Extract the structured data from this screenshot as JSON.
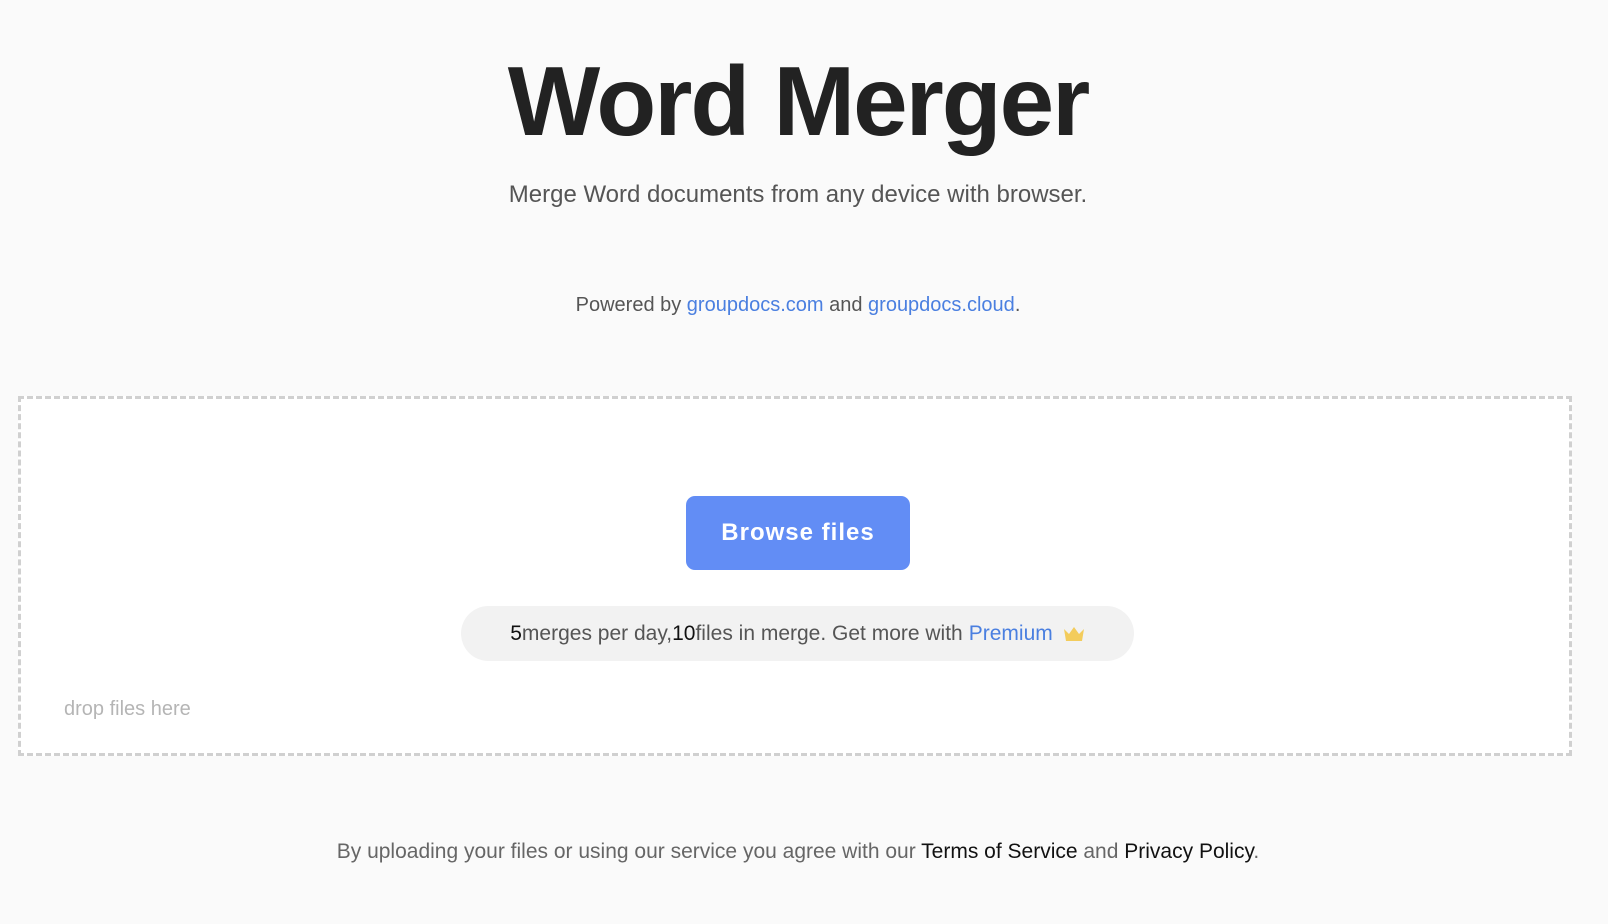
{
  "header": {
    "title": "Word Merger",
    "subtitle": "Merge Word documents from any device with browser."
  },
  "powered": {
    "prefix": "Powered by ",
    "link1": "groupdocs.com",
    "middle": " and ",
    "link2": "groupdocs.cloud",
    "suffix": "."
  },
  "dropzone": {
    "browse_label": "Browse files",
    "drop_hint": "drop files here",
    "limits": {
      "merges": "5",
      "merges_text": " merges per day, ",
      "files": "10",
      "files_text": " files in merge. Get more with",
      "premium_label": "Premium",
      "premium_icon": "crown-icon"
    }
  },
  "footer": {
    "prefix": "By uploading your files or using our service you agree with our ",
    "terms_label": "Terms of Service",
    "middle": " and ",
    "privacy_label": "Privacy Policy",
    "suffix": "."
  },
  "colors": {
    "accent": "#628df5",
    "link": "#4a7fe0",
    "crown": "#f3cc5c",
    "background": "#fafafa"
  }
}
